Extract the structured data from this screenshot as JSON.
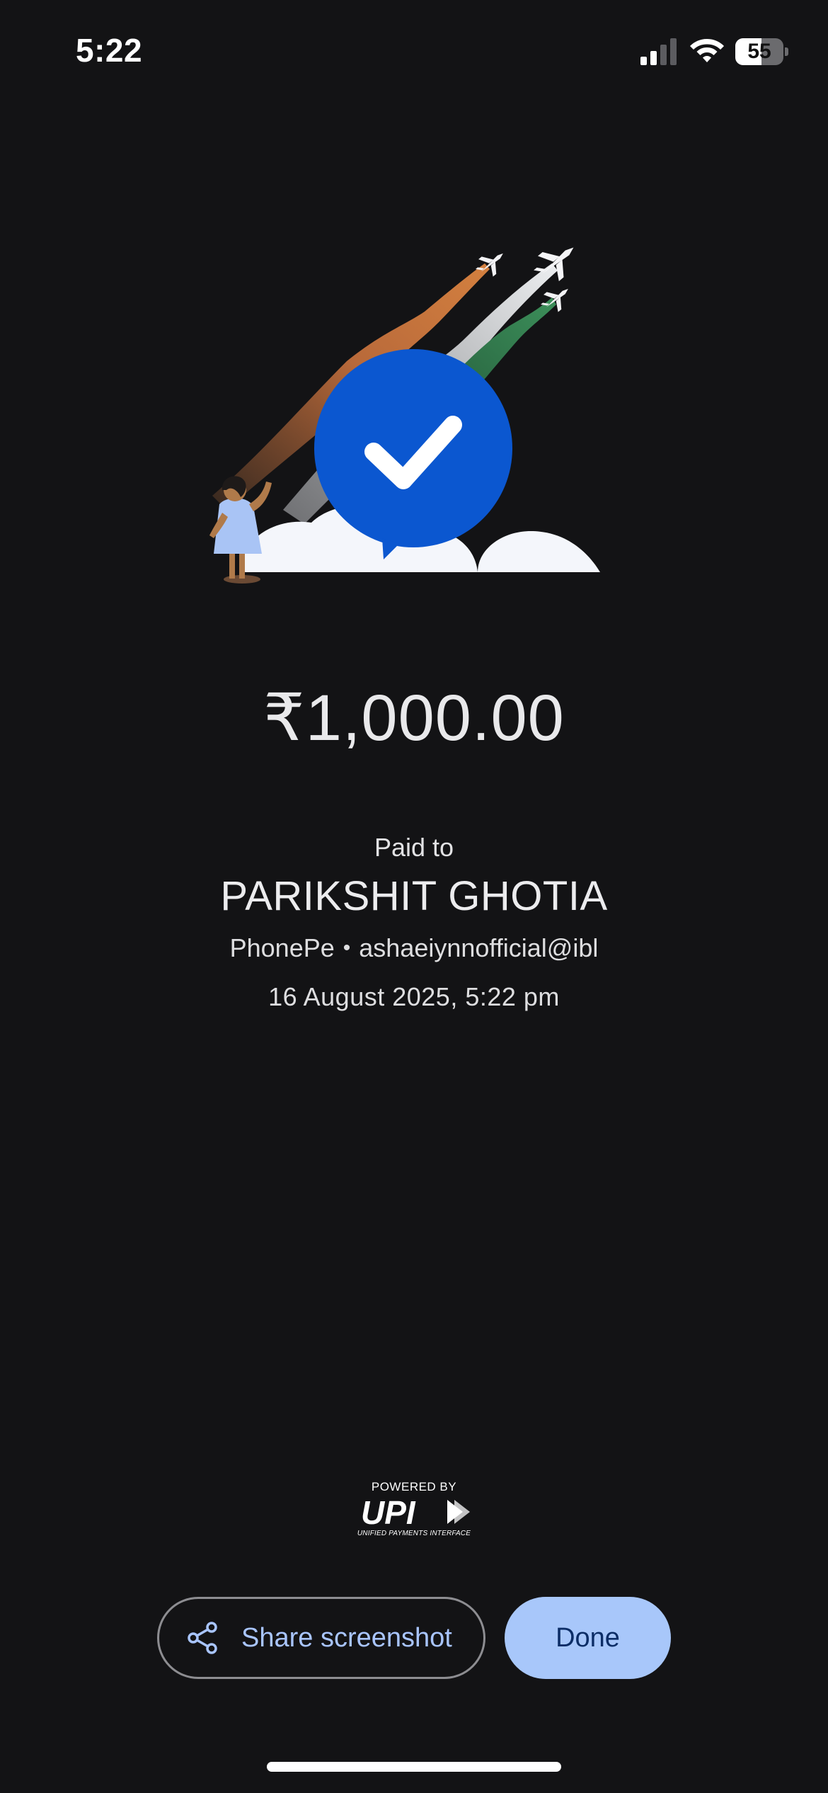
{
  "status_bar": {
    "time": "5:22",
    "battery_level": "55",
    "battery_fraction": 0.55,
    "signal_bars_active": 2,
    "signal_bars_total": 4
  },
  "icons": {
    "signal": "cellular-signal-icon",
    "wifi": "wifi-icon",
    "battery": "battery-icon",
    "success": "checkmark-icon",
    "share": "share-icon",
    "upi": "upi-logo"
  },
  "payment": {
    "amount": "₹1,000.00",
    "paid_to_label": "Paid to",
    "payee_name": "PARIKSHIT GHOTIA",
    "payee_app": "PhonePe",
    "payee_upi_id": "ashaeiynnofficial@ibl",
    "datetime": "16 August 2025, 5:22 pm"
  },
  "upi_branding": {
    "powered_by": "POWERED BY",
    "mark": "UPI",
    "subtitle": "UNIFIED PAYMENTS INTERFACE"
  },
  "actions": {
    "share_label": "Share screenshot",
    "done_label": "Done"
  },
  "colors": {
    "background": "#131315",
    "success_circle": "#0b57d0",
    "done_button": "#a8c7fa",
    "share_text": "#a9c5ff",
    "trail_saffron": "#c8743c",
    "trail_white": "#e3e4e6",
    "trail_green": "#2e7a4a"
  }
}
